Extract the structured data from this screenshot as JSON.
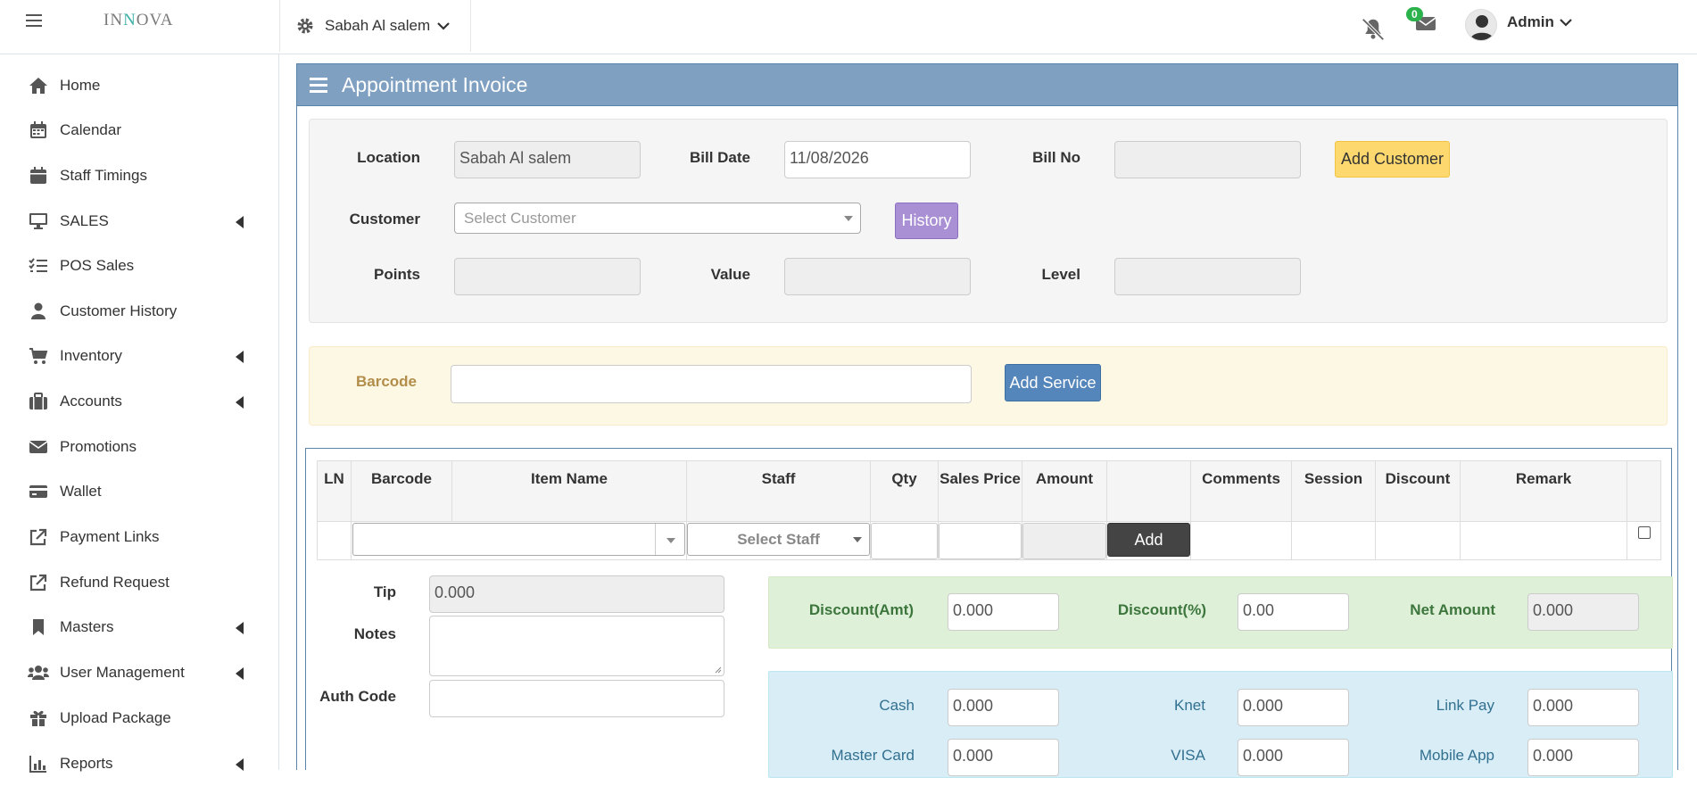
{
  "header": {
    "logo_text": "INNOVA",
    "location_selector": "Sabah Al salem",
    "message_count": "0",
    "user_name": "Admin"
  },
  "sidebar": {
    "items": [
      {
        "label": "Home",
        "icon": "home-icon",
        "has_submenu": false
      },
      {
        "label": "Calendar",
        "icon": "calendar-icon",
        "has_submenu": false
      },
      {
        "label": "Staff Timings",
        "icon": "calendar-check-icon",
        "has_submenu": false
      },
      {
        "label": "SALES",
        "icon": "desktop-icon",
        "has_submenu": true
      },
      {
        "label": "POS Sales",
        "icon": "list-check-icon",
        "has_submenu": false
      },
      {
        "label": "Customer History",
        "icon": "user-icon",
        "has_submenu": false
      },
      {
        "label": "Inventory",
        "icon": "cart-icon",
        "has_submenu": true
      },
      {
        "label": "Accounts",
        "icon": "briefcase-icon",
        "has_submenu": true
      },
      {
        "label": "Promotions",
        "icon": "envelope-icon",
        "has_submenu": false
      },
      {
        "label": "Wallet",
        "icon": "credit-card-icon",
        "has_submenu": false
      },
      {
        "label": "Payment Links",
        "icon": "external-link-icon",
        "has_submenu": false
      },
      {
        "label": "Refund Request",
        "icon": "external-link-icon",
        "has_submenu": false
      },
      {
        "label": "Masters",
        "icon": "bookmark-icon",
        "has_submenu": true
      },
      {
        "label": "User Management",
        "icon": "users-icon",
        "has_submenu": true
      },
      {
        "label": "Upload Package",
        "icon": "gift-icon",
        "has_submenu": false
      },
      {
        "label": "Reports",
        "icon": "bar-chart-icon",
        "has_submenu": true
      }
    ]
  },
  "panel": {
    "title": "Appointment Invoice"
  },
  "form": {
    "location_label": "Location",
    "location_value": "Sabah Al salem",
    "bill_date_label": "Bill Date",
    "bill_date_value": "11/08/2026",
    "bill_no_label": "Bill No",
    "bill_no_value": "",
    "add_customer_label": "Add Customer",
    "customer_label": "Customer",
    "customer_placeholder": "Select Customer",
    "history_label": "History",
    "points_label": "Points",
    "value_label": "Value",
    "level_label": "Level"
  },
  "barcode_bar": {
    "label": "Barcode",
    "value": "",
    "add_service_label": "Add Service"
  },
  "items_table": {
    "columns": [
      "LN",
      "Barcode",
      "Item Name",
      "Staff",
      "Qty",
      "Sales Price",
      "Amount",
      "",
      "Comments",
      "Session",
      "Discount",
      "Remark",
      ""
    ],
    "staff_placeholder": "Select Staff",
    "add_label": "Add"
  },
  "totals": {
    "tip_label": "Tip",
    "tip_value": "0.000",
    "notes_label": "Notes",
    "auth_code_label": "Auth Code",
    "discount_amt_label": "Discount(Amt)",
    "discount_amt_value": "0.000",
    "discount_pct_label": "Discount(%)",
    "discount_pct_value": "0.00",
    "net_amount_label": "Net Amount",
    "net_amount_value": "0.000"
  },
  "payments": {
    "cash_label": "Cash",
    "cash_value": "0.000",
    "knet_label": "Knet",
    "knet_value": "0.000",
    "link_pay_label": "Link Pay",
    "link_pay_value": "0.000",
    "master_card_label": "Master Card",
    "master_card_value": "0.000",
    "visa_label": "VISA",
    "visa_value": "0.000",
    "mobile_app_label": "Mobile App",
    "mobile_app_value": "0.000"
  }
}
